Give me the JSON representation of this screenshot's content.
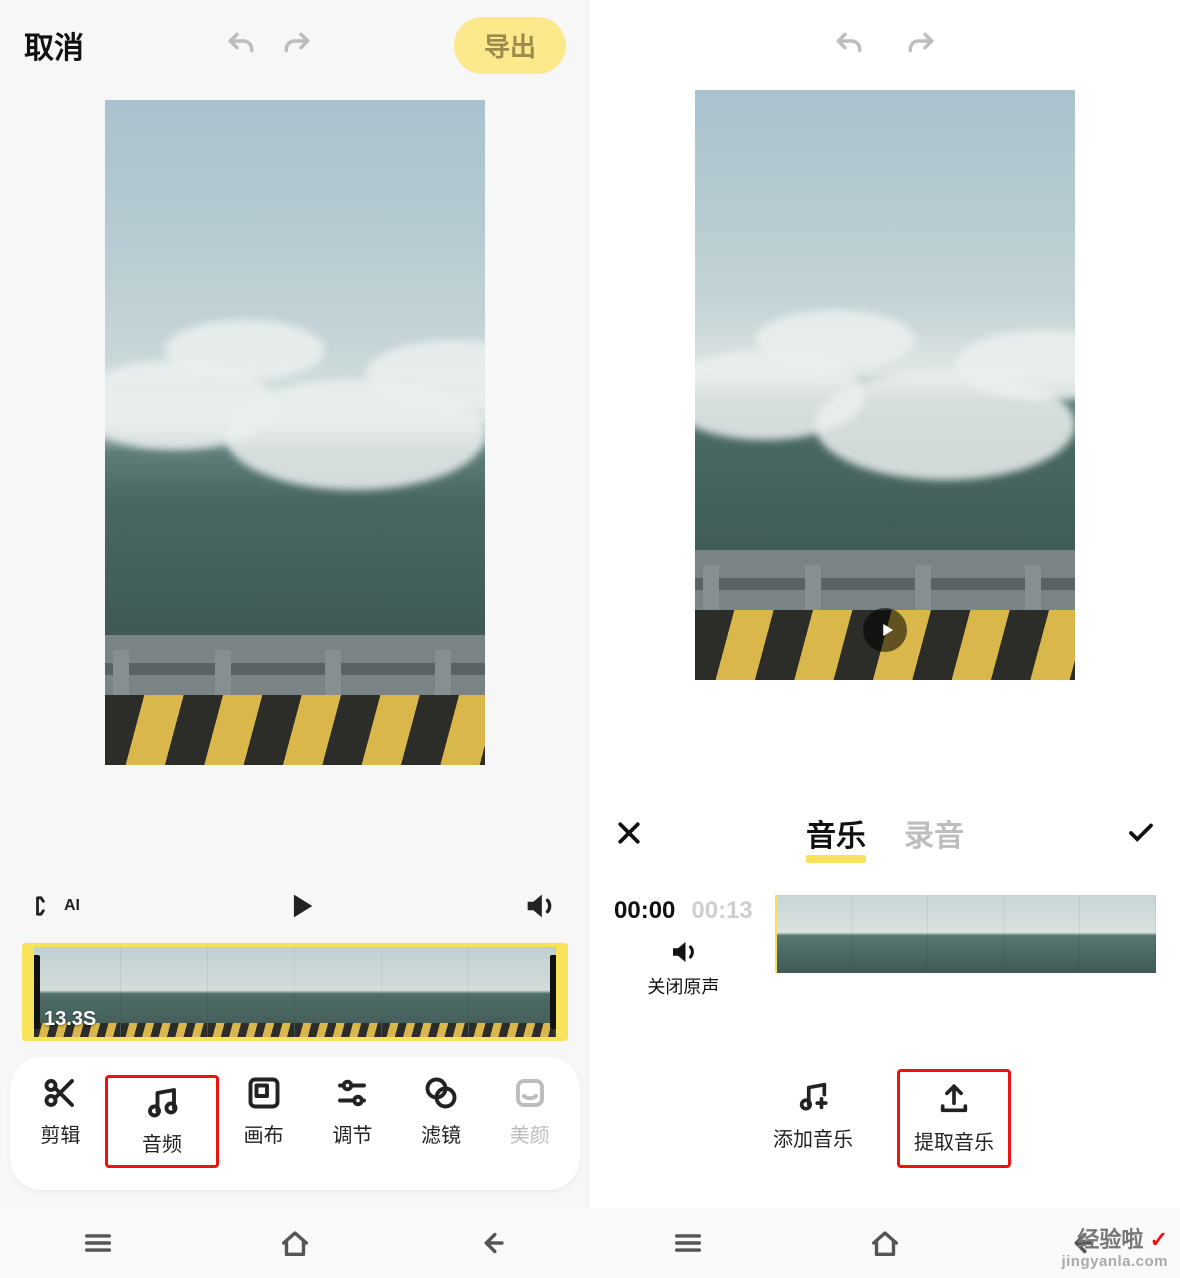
{
  "left": {
    "topbar": {
      "cancel": "取消",
      "export": "导出"
    },
    "clip_duration": "13.3S",
    "tools": [
      {
        "id": "edit",
        "label": "剪辑"
      },
      {
        "id": "audio",
        "label": "音频"
      },
      {
        "id": "canvas",
        "label": "画布"
      },
      {
        "id": "adjust",
        "label": "调节"
      },
      {
        "id": "filter",
        "label": "滤镜"
      },
      {
        "id": "beauty",
        "label": "美颜"
      }
    ],
    "highlighted_tool_index": 1
  },
  "right": {
    "panel": {
      "tabs": {
        "music": "音乐",
        "record": "录音",
        "active": "music"
      },
      "time_current": "00:00",
      "time_total": "00:13",
      "mute_label": "关闭原声",
      "actions": {
        "add_music": "添加音乐",
        "extract_music": "提取音乐"
      },
      "highlighted_action": "extract_music"
    }
  },
  "watermark": {
    "brand": "经验啦",
    "domain": "jingyanla.com"
  }
}
